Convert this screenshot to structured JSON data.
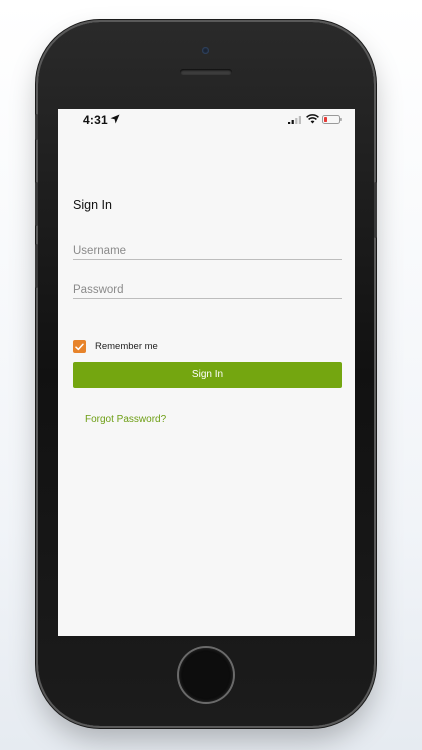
{
  "status_bar": {
    "time": "4:31",
    "location_icon": "location-arrow-icon",
    "signal_icon": "cellular-signal-icon",
    "wifi_icon": "wifi-icon",
    "battery_icon": "battery-low-icon",
    "battery_color": "#e53935"
  },
  "login": {
    "title": "Sign In",
    "username_placeholder": "Username",
    "password_placeholder": "Password",
    "remember_label": "Remember me",
    "remember_checked": true,
    "signin_label": "Sign In",
    "forgot_label": "Forgot Password?"
  },
  "colors": {
    "accent_green": "#74a610",
    "link_green": "#6d9e14",
    "checkbox_orange": "#e7832a",
    "screen_background": "#f7f7f7"
  }
}
